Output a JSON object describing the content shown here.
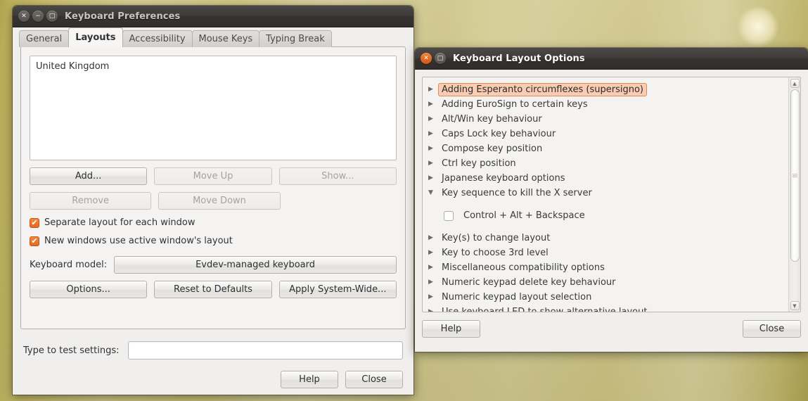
{
  "keyboard_preferences": {
    "title": "Keyboard Preferences",
    "window_buttons": {
      "close": "close-icon",
      "minimize": "minimize-icon",
      "maximize": "maximize-icon"
    },
    "tabs": [
      {
        "label": "General",
        "active": false
      },
      {
        "label": "Layouts",
        "active": true
      },
      {
        "label": "Accessibility",
        "active": false
      },
      {
        "label": "Mouse Keys",
        "active": false
      },
      {
        "label": "Typing Break",
        "active": false
      }
    ],
    "layout_list": [
      "United Kingdom"
    ],
    "layout_buttons": [
      {
        "label": "Add...",
        "enabled": true
      },
      {
        "label": "Move Up",
        "enabled": false
      },
      {
        "label": "Show...",
        "enabled": false
      },
      {
        "label": "Remove",
        "enabled": false
      },
      {
        "label": "Move Down",
        "enabled": false
      }
    ],
    "checkboxes": [
      {
        "label": "Separate layout for each window",
        "checked": true
      },
      {
        "label": "New windows use active window's layout",
        "checked": true
      }
    ],
    "keyboard_model": {
      "label": "Keyboard model:",
      "value": "Evdev-managed keyboard"
    },
    "action_buttons": [
      "Options...",
      "Reset to Defaults",
      "Apply System-Wide..."
    ],
    "test_settings": {
      "label": "Type to test settings:",
      "value": "",
      "placeholder": ""
    },
    "dialog_buttons": {
      "help": "Help",
      "close": "Close"
    }
  },
  "keyboard_layout_options": {
    "title": "Keyboard Layout Options",
    "window_buttons": {
      "close": "close-icon",
      "maximize": "maximize-icon"
    },
    "tree": [
      {
        "label": "Adding Esperanto circumflexes (supersigno)",
        "expanded": false,
        "selected": true,
        "type": "group"
      },
      {
        "label": "Adding EuroSign to certain keys",
        "expanded": false,
        "selected": false,
        "type": "group"
      },
      {
        "label": "Alt/Win key behaviour",
        "expanded": false,
        "selected": false,
        "type": "group"
      },
      {
        "label": "Caps Lock key behaviour",
        "expanded": false,
        "selected": false,
        "type": "group"
      },
      {
        "label": "Compose key position",
        "expanded": false,
        "selected": false,
        "type": "group"
      },
      {
        "label": "Ctrl key position",
        "expanded": false,
        "selected": false,
        "type": "group"
      },
      {
        "label": "Japanese keyboard options",
        "expanded": false,
        "selected": false,
        "type": "group"
      },
      {
        "label": "Key sequence to kill the X server",
        "expanded": true,
        "selected": false,
        "type": "group"
      },
      {
        "label": "Control + Alt + Backspace",
        "checked": false,
        "type": "child"
      },
      {
        "label": "Key(s) to change layout",
        "expanded": false,
        "selected": false,
        "type": "group"
      },
      {
        "label": "Key to choose 3rd level",
        "expanded": false,
        "selected": false,
        "type": "group"
      },
      {
        "label": "Miscellaneous compatibility options",
        "expanded": false,
        "selected": false,
        "type": "group"
      },
      {
        "label": "Numeric keypad delete key behaviour",
        "expanded": false,
        "selected": false,
        "type": "group"
      },
      {
        "label": "Numeric keypad layout selection",
        "expanded": false,
        "selected": false,
        "type": "group"
      },
      {
        "label": "Use keyboard LED to show alternative layout",
        "expanded": false,
        "selected": false,
        "type": "group"
      }
    ],
    "dialog_buttons": {
      "help": "Help",
      "close": "Close"
    },
    "scrollbar": {
      "up_arrow": "triangle-up-icon",
      "down_arrow": "triangle-down-icon"
    }
  },
  "glyphs": {
    "close": "✕",
    "minimize": "−",
    "maximize": "□",
    "check": "✔",
    "collapsed": "▶",
    "expanded": "▼",
    "arrow_up": "▲",
    "arrow_down": "▼"
  },
  "colors": {
    "accent_orange": "#e4691e",
    "selection_bg": "#f9cdb4",
    "selection_border": "#e08a53",
    "window_bg": "#f1efed",
    "titlebar_dark": "#3a3735"
  }
}
